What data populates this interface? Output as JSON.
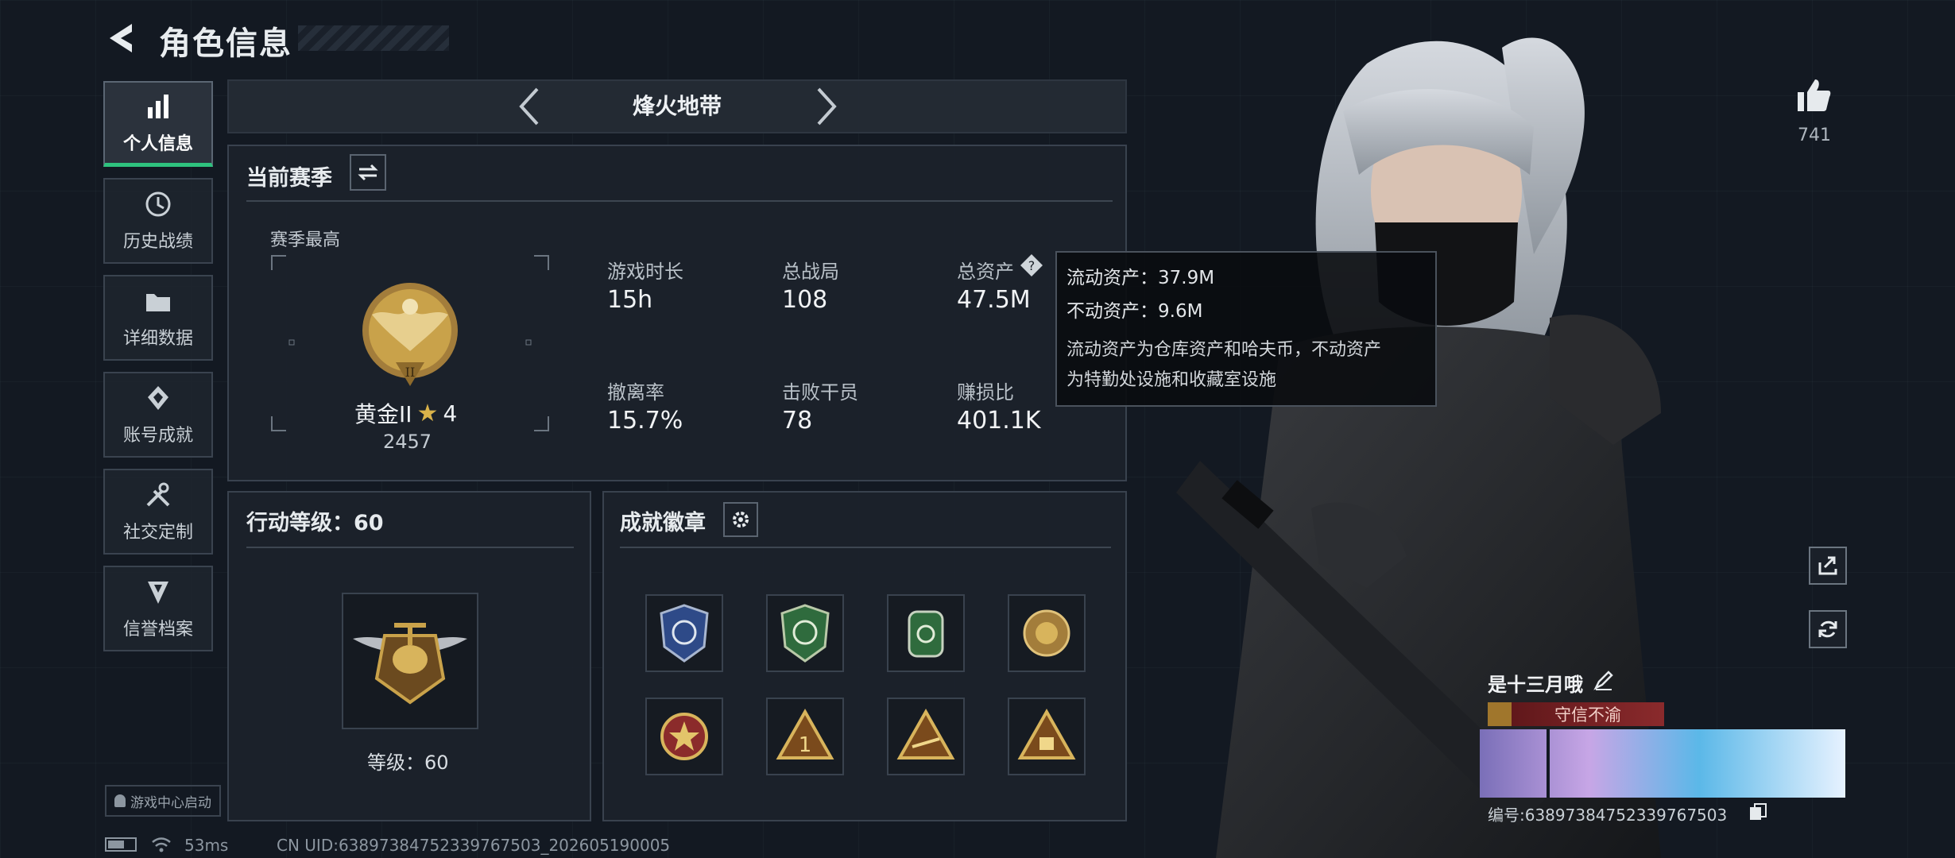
{
  "header": {
    "title": "角色信息"
  },
  "sidebar": {
    "items": [
      {
        "label": "个人信息",
        "icon": "bar-chart-icon",
        "active": true
      },
      {
        "label": "历史战绩",
        "icon": "history-icon"
      },
      {
        "label": "详细数据",
        "icon": "folder-icon"
      },
      {
        "label": "账号成就",
        "icon": "achievement-icon"
      },
      {
        "label": "社交定制",
        "icon": "tools-icon"
      },
      {
        "label": "信誉档案",
        "icon": "reputation-icon"
      }
    ],
    "launch_label": "游戏中心启动"
  },
  "mode": {
    "title": "烽火地带"
  },
  "season": {
    "title": "当前赛季",
    "best_label": "赛季最高",
    "rank_name": "黄金II",
    "rank_stars": "4",
    "rank_score": "2457",
    "stats": [
      {
        "label": "游戏时长",
        "value": "15h"
      },
      {
        "label": "总战局",
        "value": "108"
      },
      {
        "label": "总资产",
        "value": "47.5M"
      },
      {
        "label": "撤离率",
        "value": "15.7%"
      },
      {
        "label": "击败干员",
        "value": "78"
      },
      {
        "label": "赚损比",
        "value": "401.1K"
      }
    ]
  },
  "tooltip": {
    "liquid": "流动资产：37.9M",
    "fixed": "不动资产：9.6M",
    "desc_line1": "流动资产为仓库资产和哈夫币，不动资产",
    "desc_line2": "为特勤处设施和收藏室设施"
  },
  "action_level": {
    "title": "行动等级：60",
    "level_text": "等级：60"
  },
  "achievements": {
    "title": "成就徽章"
  },
  "likes": {
    "count": "741"
  },
  "player": {
    "name": "是十三月哦",
    "title_badge": "守信不渝",
    "id_text": "编号:638973847523397675​03"
  },
  "footer": {
    "ping": "53ms",
    "uid": "CN UID:638973847523397675​03_202605190005"
  },
  "colors": {
    "accent": "#2ec27e",
    "gold": "#c9a24a",
    "title_red": "#7a1f22"
  }
}
